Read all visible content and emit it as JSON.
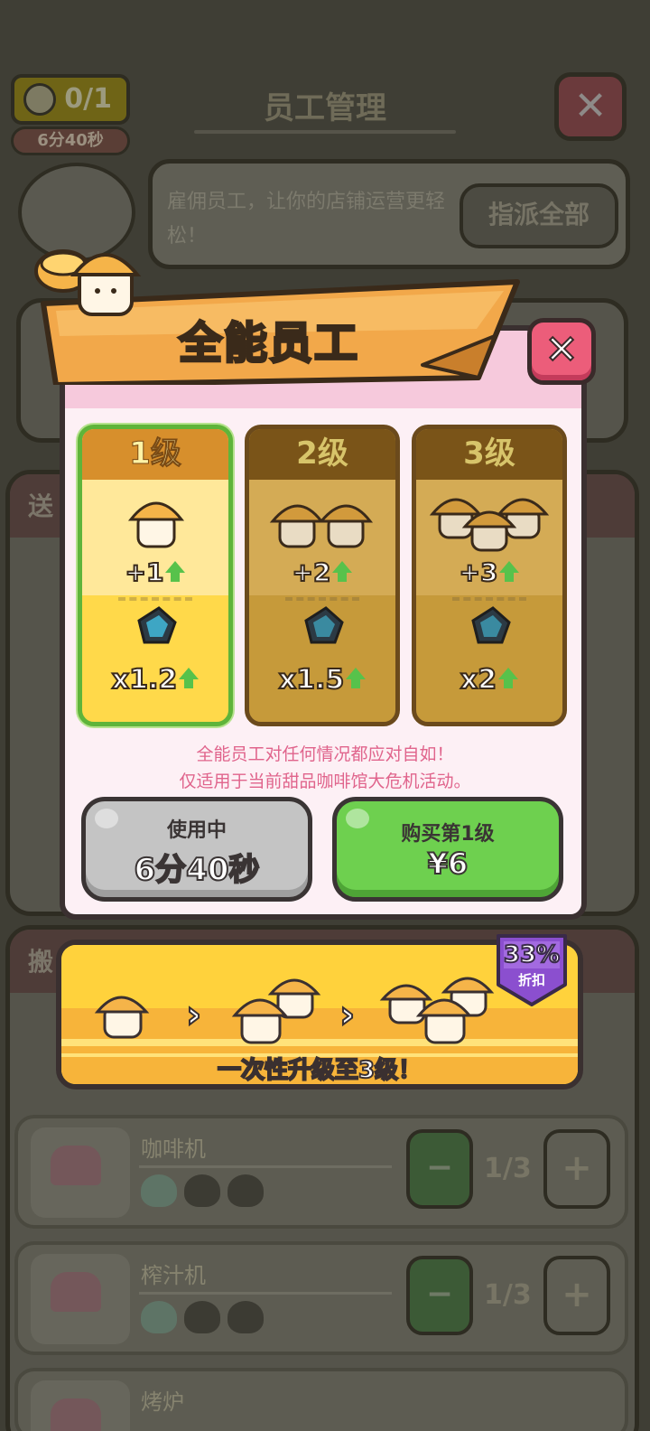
{
  "background": {
    "title": "员工管理",
    "counter": "0/1",
    "timer": "6分40秒",
    "speech": "雇佣员工，让你的店铺运营更轻松！",
    "assign_all": "指派全部",
    "section1_title": "送",
    "section2_title": "搬",
    "rows": [
      {
        "name": "咖啡机",
        "count": "1/3"
      },
      {
        "name": "榨汁机",
        "count": "1/3"
      },
      {
        "name": "烤炉",
        "count": ""
      }
    ],
    "minus_label": "−",
    "plus_label": "+"
  },
  "popup": {
    "title": "全能员工",
    "close_label": "✕",
    "levels": [
      {
        "label": "1级",
        "staff_bonus": "+1",
        "multiplier": "x1.2",
        "selected": true
      },
      {
        "label": "2级",
        "staff_bonus": "+2",
        "multiplier": "x1.5",
        "selected": false
      },
      {
        "label": "3级",
        "staff_bonus": "+3",
        "multiplier": "x2",
        "selected": false
      }
    ],
    "desc_line1": "全能员工对任何情况都应对自如！",
    "desc_line2": "仅适用于当前甜品咖啡馆大危机活动。",
    "in_use_button": {
      "label": "使用中",
      "time": "6分40秒"
    },
    "buy_button": {
      "label": "购买第1级",
      "price": "¥6"
    }
  },
  "offer": {
    "text": "一次性升级至3级！",
    "discount_pct": "33%",
    "discount_label": "折扣",
    "chevron": "›"
  },
  "colors": {
    "selected_card": "#ffe27a",
    "locked_card": "#c69a3a",
    "in_use_button": "#c4c4c4",
    "buy_button": "#6ed04f",
    "close_button": "#ec5d7a",
    "badge": "#8b4fcf"
  },
  "icons": {
    "staff": "staff-cap-icon",
    "gem": "gem-icon",
    "arrow": "up-arrow-icon",
    "close": "close-icon"
  }
}
